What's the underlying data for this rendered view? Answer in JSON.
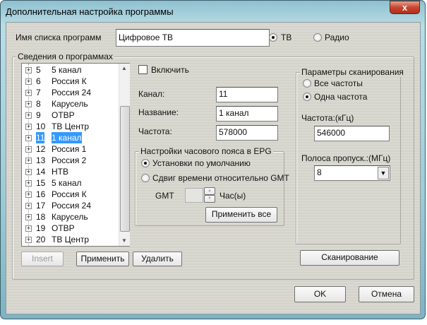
{
  "window": {
    "title": "Дополнительная настройка программы",
    "close": "x"
  },
  "list_name": {
    "label": "Имя списка программ",
    "value": "Цифровое ТВ",
    "radio_tv": "ТВ",
    "radio_radio": "Радио",
    "selected": "ТВ"
  },
  "programs_group": {
    "title": "Сведения о программах",
    "items": [
      {
        "num": "5",
        "name": "5 канал"
      },
      {
        "num": "6",
        "name": "Россия К"
      },
      {
        "num": "7",
        "name": "Россия 24"
      },
      {
        "num": "8",
        "name": "Карусель"
      },
      {
        "num": "9",
        "name": "ОТВР"
      },
      {
        "num": "10",
        "name": "ТВ Центр"
      },
      {
        "num": "11",
        "name": "1 канал"
      },
      {
        "num": "12",
        "name": "Россия 1"
      },
      {
        "num": "13",
        "name": "Россия 2"
      },
      {
        "num": "14",
        "name": "НТВ"
      },
      {
        "num": "15",
        "name": "5 канал"
      },
      {
        "num": "16",
        "name": "Россия К"
      },
      {
        "num": "17",
        "name": "Россия 24"
      },
      {
        "num": "18",
        "name": "Карусель"
      },
      {
        "num": "19",
        "name": "ОТВР"
      },
      {
        "num": "20",
        "name": "ТВ Центр"
      }
    ],
    "selected_index": 6,
    "enable_label": "Включить",
    "enable_checked": false,
    "channel_label": "Канал:",
    "channel_value": "11",
    "name_label": "Название:",
    "name_value": "1 канал",
    "freq_label": "Частота:",
    "freq_value": "578000",
    "insert": "Insert",
    "apply": "Применить",
    "delete": "Удалить"
  },
  "epg": {
    "title": "Настройки часового пояса в EPG",
    "default": "Установки по умолчанию",
    "offset": "Сдвиг времени относительно GMT",
    "gmt": "GMT",
    "gmt_value": "",
    "hours": "Час(ы)",
    "apply_all": "Применить все"
  },
  "scan": {
    "title": "Параметры сканирования",
    "all": "Все частоты",
    "one": "Одна частота",
    "freq_label": "Частота:(кГц)",
    "freq_value": "546000",
    "band_label": "Полоса пропуск.:(МГц)",
    "band_value": "8",
    "scan_button": "Сканирование"
  },
  "footer": {
    "ok": "OK",
    "cancel": "Отмена"
  }
}
